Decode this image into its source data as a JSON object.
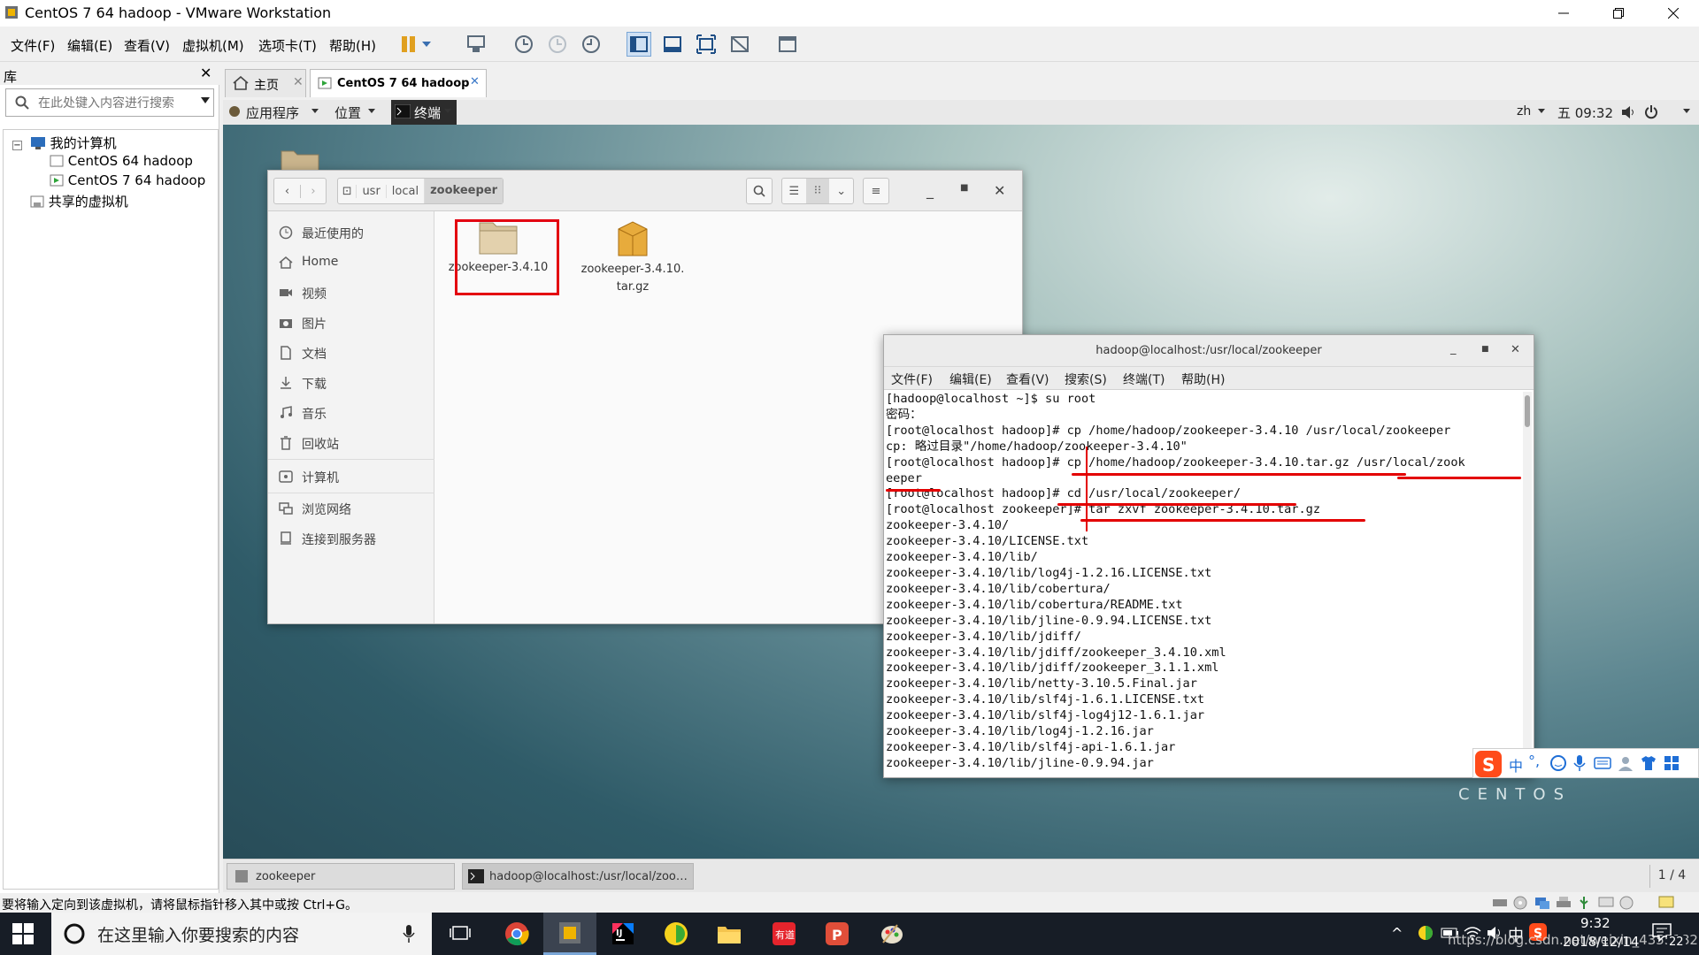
{
  "window": {
    "title": "CentOS 7 64 hadoop - VMware Workstation"
  },
  "menubar": {
    "items": [
      "文件(F)",
      "编辑(E)",
      "查看(V)",
      "虚拟机(M)",
      "选项卡(T)",
      "帮助(H)"
    ]
  },
  "library": {
    "title": "库",
    "search_placeholder": "在此处键入内容进行搜索",
    "tree": [
      "我的计算机",
      "CentOS 64 hadoop",
      "CentOS 7 64 hadoop",
      "共享的虚拟机"
    ]
  },
  "tabs": [
    {
      "label": "主页"
    },
    {
      "label": "CentOS 7 64 hadoop"
    }
  ],
  "gnome_bar": {
    "applications": "应用程序",
    "places": "位置",
    "terminal": "终端",
    "lang": "zh",
    "clock": "五 09:32"
  },
  "files": {
    "path": [
      "usr",
      "local",
      "zookeeper"
    ],
    "sidebar": [
      "最近使用的",
      "Home",
      "视频",
      "图片",
      "文档",
      "下载",
      "音乐",
      "回收站",
      "计算机",
      "浏览网络",
      "连接到服务器"
    ],
    "items": [
      {
        "name": "zookeeper-3.4.10",
        "kind": "folder"
      },
      {
        "name": "zookeeper-3.4.10.\ntar.gz",
        "kind": "archive"
      }
    ]
  },
  "terminal": {
    "title": "hadoop@localhost:/usr/local/zookeeper",
    "menu": [
      "文件(F)",
      "编辑(E)",
      "查看(V)",
      "搜索(S)",
      "终端(T)",
      "帮助(H)"
    ],
    "lines": [
      "[hadoop@localhost ~]$ su root",
      "密码：",
      "[root@localhost hadoop]# cp /home/hadoop/zookeeper-3.4.10 /usr/local/zookeeper",
      "cp: 略过目录\"/home/hadoop/zookeeper-3.4.10\"",
      "[root@localhost hadoop]# cp /home/hadoop/zookeeper-3.4.10.tar.gz /usr/local/zook",
      "eeper",
      "[root@localhost hadoop]# cd /usr/local/zookeeper/",
      "[root@localhost zookeeper]# tar zxvf zookeeper-3.4.10.tar.gz",
      "zookeeper-3.4.10/",
      "zookeeper-3.4.10/LICENSE.txt",
      "zookeeper-3.4.10/lib/",
      "zookeeper-3.4.10/lib/log4j-1.2.16.LICENSE.txt",
      "zookeeper-3.4.10/lib/cobertura/",
      "zookeeper-3.4.10/lib/cobertura/README.txt",
      "zookeeper-3.4.10/lib/jline-0.9.94.LICENSE.txt",
      "zookeeper-3.4.10/lib/jdiff/",
      "zookeeper-3.4.10/lib/jdiff/zookeeper_3.4.10.xml",
      "zookeeper-3.4.10/lib/jdiff/zookeeper_3.1.1.xml",
      "zookeeper-3.4.10/lib/netty-3.10.5.Final.jar",
      "zookeeper-3.4.10/lib/slf4j-1.6.1.LICENSE.txt",
      "zookeeper-3.4.10/lib/slf4j-log4j12-1.6.1.jar",
      "zookeeper-3.4.10/lib/log4j-1.2.16.jar",
      "zookeeper-3.4.10/lib/slf4j-api-1.6.1.jar",
      "zookeeper-3.4.10/lib/jline-0.9.94.jar"
    ]
  },
  "desktop": {
    "brand": "CENTOS"
  },
  "guest_taskbar": {
    "items": [
      "zookeeper",
      "hadoop@localhost:/usr/local/zoo…"
    ],
    "page": "1 / 4"
  },
  "status": {
    "message": "要将输入定向到该虚拟机，请将鼠标指针移入其中或按 Ctrl+G。"
  },
  "windows_taskbar": {
    "search_placeholder": "在这里输入你要搜索的内容",
    "time": "9:32",
    "date": "2018/12/14",
    "ime": "中",
    "notifications": "22",
    "watermark": "https://blog.csdn.net/weixin_43551829"
  },
  "colors": {
    "annotation": "#e30000",
    "highlight_tab": "#ffffff"
  }
}
